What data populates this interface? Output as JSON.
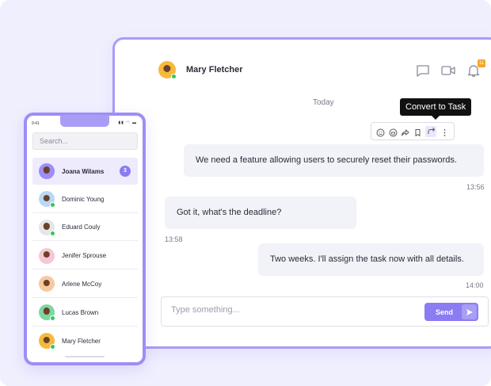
{
  "colors": {
    "accent": "#8a7cf3",
    "frame": "#a99cf6",
    "background": "#f0effe",
    "bubble": "#f2f2f9",
    "online": "#34c759",
    "badge": "#f5a623"
  },
  "chat": {
    "contact_name": "Mary Fletcher",
    "header_icons": [
      "chat-bubble-icon",
      "video-camera-icon",
      "bell-icon"
    ],
    "notification_count": "11",
    "date_separator": "Today",
    "tooltip": "Convert to Task",
    "message_actions": [
      "emoji-icon",
      "smile-icon",
      "share-icon",
      "bookmark-icon",
      "convert-forward-icon",
      "more-icon"
    ],
    "messages": [
      {
        "text": "We need a feature allowing users to securely reset their passwords.",
        "time": "13:56",
        "side": "right"
      },
      {
        "text": "Got it, what's the deadline?",
        "time": "13:58",
        "side": "left"
      },
      {
        "text": "Two weeks. I'll assign the task now with all details.",
        "time": "14:00",
        "side": "right"
      }
    ],
    "compose": {
      "placeholder": "Type something...",
      "send_label": "Send"
    }
  },
  "phone": {
    "status_time": "9:41",
    "search_placeholder": "Search...",
    "contacts": [
      {
        "name": "Joana Wilams",
        "unread": "3",
        "active": true,
        "avatar_color": "#9d8ef7",
        "online": false
      },
      {
        "name": "Dominic Young",
        "unread": "",
        "active": false,
        "avatar_color": "#b9d8f5",
        "online": true
      },
      {
        "name": "Eduard Couly",
        "unread": "",
        "active": false,
        "avatar_color": "#e6e6ea",
        "online": true
      },
      {
        "name": "Jenifer Sprouse",
        "unread": "",
        "active": false,
        "avatar_color": "#f6c6d6",
        "online": false
      },
      {
        "name": "Arlene McCoy",
        "unread": "",
        "active": false,
        "avatar_color": "#f7c9a0",
        "online": false
      },
      {
        "name": "Lucas Brown",
        "unread": "",
        "active": false,
        "avatar_color": "#7fd6a1",
        "online": true
      },
      {
        "name": "Mary Fletcher",
        "unread": "",
        "active": false,
        "avatar_color": "#f5b93d",
        "online": true
      }
    ]
  }
}
